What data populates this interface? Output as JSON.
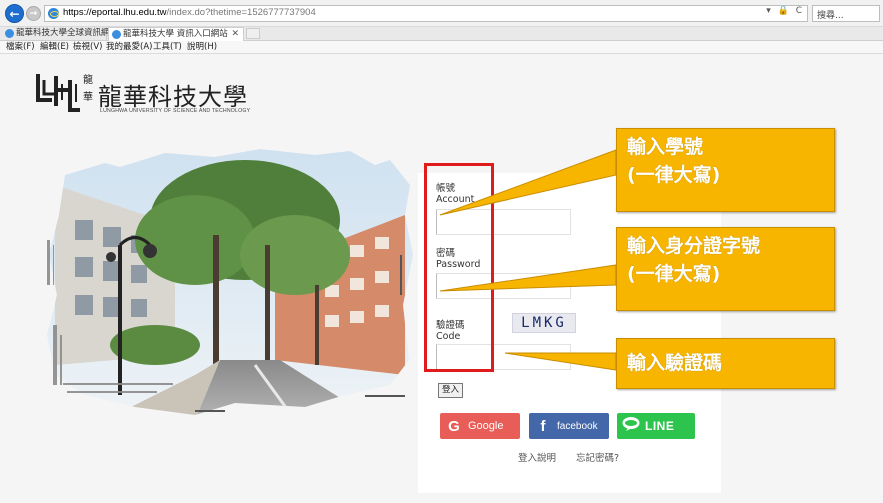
{
  "browser": {
    "url_domain": "https://eportal.lhu.edu.tw",
    "url_path": "/index.do?thetime=1526777737904",
    "address_icons": "▾ 🔒 C",
    "search_placeholder": "搜尋...",
    "tabs": [
      {
        "label": "龍華科技大學全球資訊網",
        "active": false
      },
      {
        "label": "龍華科技大學 資訊入口網站",
        "active": true
      }
    ],
    "tab_close": "✕",
    "menu": [
      "檔案(F)",
      "編輯(E)",
      "檢視(V)",
      "我的最愛(A)",
      "工具(T)",
      "說明(H)"
    ]
  },
  "logo": {
    "title": "龍華科技大學",
    "subtitle": "LUNGHWA UNIVERSITY OF SCIENCE AND TECHNOLOGY"
  },
  "login": {
    "account_label": "帳號\nAccount",
    "password_label": "密碼\nPassword",
    "code_label": "驗證碼\nCode",
    "captcha": "LMKG",
    "login_button": "登入",
    "google": "Google",
    "facebook": "facebook",
    "line": "LINE",
    "help_link": "登入說明",
    "forgot_link": "忘記密碼?"
  },
  "annotations": {
    "account_hint": "輸入學號\n(一律大寫)",
    "password_hint": "輸入身分證字號\n(一律大寫)",
    "code_hint": "輸入驗證碼"
  },
  "colors": {
    "callout": "#f7b500",
    "highlight_box": "#e01b1b",
    "google": "#e85d57",
    "facebook": "#4367a8",
    "line": "#2cc44c"
  }
}
